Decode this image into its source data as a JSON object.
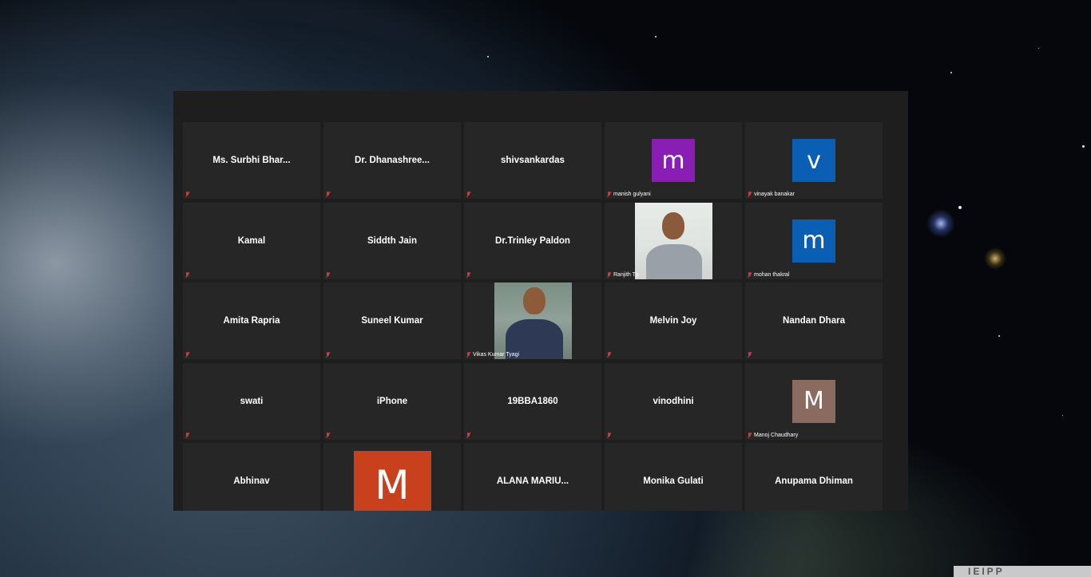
{
  "participants": [
    {
      "name": "Ms. Surbhi Bhar...",
      "display": "name"
    },
    {
      "name": "Dr. Dhanashree...",
      "display": "name"
    },
    {
      "name": "shivsankardas",
      "display": "name"
    },
    {
      "name": "manish gulyani",
      "display": "avatar",
      "initial": "m",
      "color": "#8a1eb4"
    },
    {
      "name": "vinayak banakar",
      "display": "avatar",
      "initial": "v",
      "color": "#0a5fb4"
    },
    {
      "name": "Kamal",
      "display": "name"
    },
    {
      "name": "Siddth Jain",
      "display": "name"
    },
    {
      "name": "Dr.Trinley Paldon",
      "display": "name"
    },
    {
      "name": "Ranjith Tp",
      "display": "video"
    },
    {
      "name": "mohan thakral",
      "display": "avatar",
      "initial": "m",
      "color": "#0a5fb4"
    },
    {
      "name": "Amita Rapria",
      "display": "name"
    },
    {
      "name": "Suneel Kumar",
      "display": "name"
    },
    {
      "name": "Vikas Kumar Tyagi",
      "display": "video"
    },
    {
      "name": "Melvin Joy",
      "display": "name"
    },
    {
      "name": "Nandan Dhara",
      "display": "name"
    },
    {
      "name": "swati",
      "display": "name"
    },
    {
      "name": "iPhone",
      "display": "name"
    },
    {
      "name": "19BBA1860",
      "display": "name"
    },
    {
      "name": "vinodhini",
      "display": "name"
    },
    {
      "name": "Manoj Chaudhary",
      "display": "avatar",
      "initial": "M",
      "color": "#8b6a5f"
    },
    {
      "name": "Abhinav",
      "display": "name"
    },
    {
      "name": "",
      "display": "avatar-large",
      "initial": "M",
      "color": "#c8401c"
    },
    {
      "name": "ALANA  MARIU...",
      "display": "name"
    },
    {
      "name": "Monika Gulati",
      "display": "name"
    },
    {
      "name": "Anupama Dhiman",
      "display": "name"
    }
  ],
  "icons": {
    "mute": "mic-muted-icon"
  },
  "corner_logo": "IEIPP"
}
